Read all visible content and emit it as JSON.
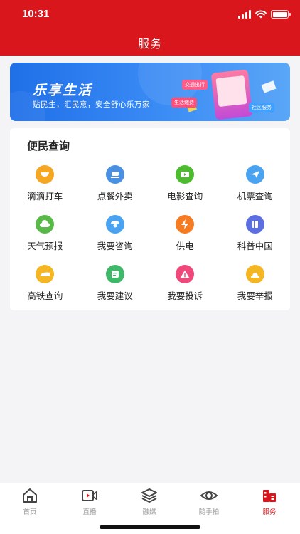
{
  "status_bar": {
    "time": "10:31"
  },
  "header": {
    "title": "服务"
  },
  "banner": {
    "title": "乐享生活",
    "subtitle": "贴民生，汇民意，安全舒心乐万家",
    "tags": [
      "交通出行",
      "生活缴费",
      "社区服务"
    ]
  },
  "section": {
    "title": "便民查询",
    "items": [
      {
        "label": "滴滴打车",
        "icon": "taxi-icon",
        "color": "#f5a623"
      },
      {
        "label": "点餐外卖",
        "icon": "takeout-icon",
        "color": "#4a90e2"
      },
      {
        "label": "电影查询",
        "icon": "movie-icon",
        "color": "#4cbb2e"
      },
      {
        "label": "机票查询",
        "icon": "plane-icon",
        "color": "#4aa3f0"
      },
      {
        "label": "天气预报",
        "icon": "weather-icon",
        "color": "#58b848"
      },
      {
        "label": "我要咨询",
        "icon": "consult-icon",
        "color": "#4aa3f0"
      },
      {
        "label": "供电",
        "icon": "power-icon",
        "color": "#f57c23"
      },
      {
        "label": "科普中国",
        "icon": "book-icon",
        "color": "#5b6fe0"
      },
      {
        "label": "高铁查询",
        "icon": "train-icon",
        "color": "#f5b623"
      },
      {
        "label": "我要建议",
        "icon": "suggest-icon",
        "color": "#3fb86a"
      },
      {
        "label": "我要投诉",
        "icon": "complaint-icon",
        "color": "#f0487a"
      },
      {
        "label": "我要举报",
        "icon": "report-icon",
        "color": "#f5b623"
      }
    ]
  },
  "tabbar": {
    "items": [
      {
        "label": "首页",
        "icon": "home-icon",
        "active": false
      },
      {
        "label": "直播",
        "icon": "live-icon",
        "active": false
      },
      {
        "label": "融媒",
        "icon": "media-icon",
        "active": false
      },
      {
        "label": "随手拍",
        "icon": "eye-icon",
        "active": false
      },
      {
        "label": "服务",
        "icon": "service-icon",
        "active": true
      }
    ],
    "active_color": "#d9161c",
    "inactive_color": "#9a9a9a"
  },
  "colors": {
    "brand_red": "#d9161c",
    "banner_blue": "#2a7cf0"
  }
}
